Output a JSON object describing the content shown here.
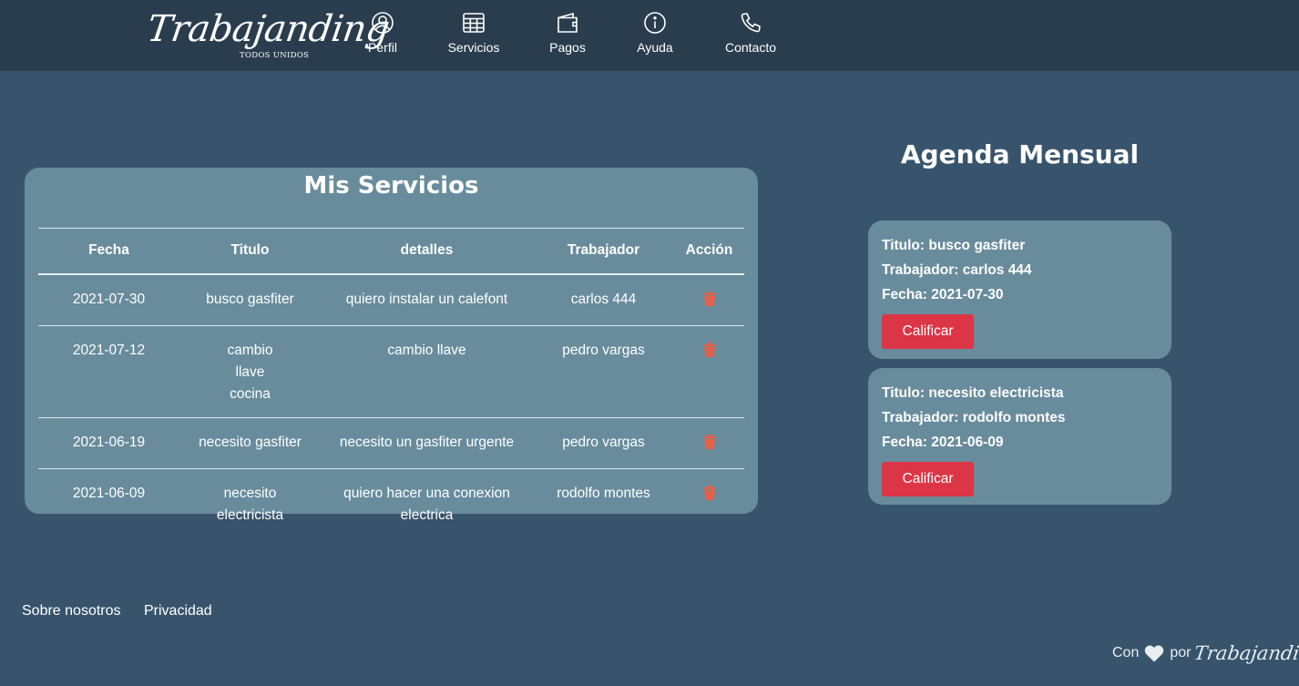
{
  "navbar": {
    "brand": "Trabajanding",
    "brand_sub": "TODOS UNIDOS",
    "items": [
      {
        "label": "Perfil",
        "icon": "user-circle-icon"
      },
      {
        "label": "Servicios",
        "icon": "table-grid-icon"
      },
      {
        "label": "Pagos",
        "icon": "wallet-icon"
      },
      {
        "label": "Ayuda",
        "icon": "info-circle-icon"
      },
      {
        "label": "Contacto",
        "icon": "phone-icon"
      }
    ]
  },
  "services": {
    "title": "Mis Servicios",
    "columns": [
      "Fecha",
      "Titulo",
      "detalles",
      "Trabajador",
      "Acción"
    ],
    "rows": [
      {
        "fecha": "2021-07-30",
        "titulo": "busco gasfiter",
        "detalles": "quiero instalar un calefont",
        "trabajador": "carlos 444"
      },
      {
        "fecha": "2021-07-12",
        "titulo": "cambio llave cocina",
        "detalles": "cambio llave",
        "trabajador": "pedro vargas"
      },
      {
        "fecha": "2021-06-19",
        "titulo": "necesito gasfiter",
        "detalles": "necesito un gasfiter urgente",
        "trabajador": "pedro vargas"
      },
      {
        "fecha": "2021-06-09",
        "titulo": "necesito electricista",
        "detalles": "quiero hacer una conexion electrica",
        "trabajador": "rodolfo montes"
      }
    ],
    "action_icon": "trash-icon",
    "action_color": "#e4604a"
  },
  "agenda": {
    "title": "Agenda Mensual",
    "items": [
      {
        "titulo": "Titulo: busco gasfiter",
        "trabajador": "Trabajador: carlos 444",
        "fecha": "Fecha: 2021-07-30",
        "button": "Calificar"
      },
      {
        "titulo": "Titulo: necesito electricista",
        "trabajador": "Trabajador: rodolfo montes",
        "fecha": "Fecha: 2021-06-09",
        "button": "Calificar"
      }
    ]
  },
  "footer": {
    "links": [
      "Sobre nosotros",
      "Privacidad"
    ],
    "credit_prefix": "Con",
    "credit_icon": "heart-icon",
    "credit_middle": "por",
    "credit_brand": "Trabajanding"
  },
  "colors": {
    "background": "#38546c",
    "navbar": "#2a3d4e",
    "card": "#688c9c",
    "button": "#dc3545"
  }
}
